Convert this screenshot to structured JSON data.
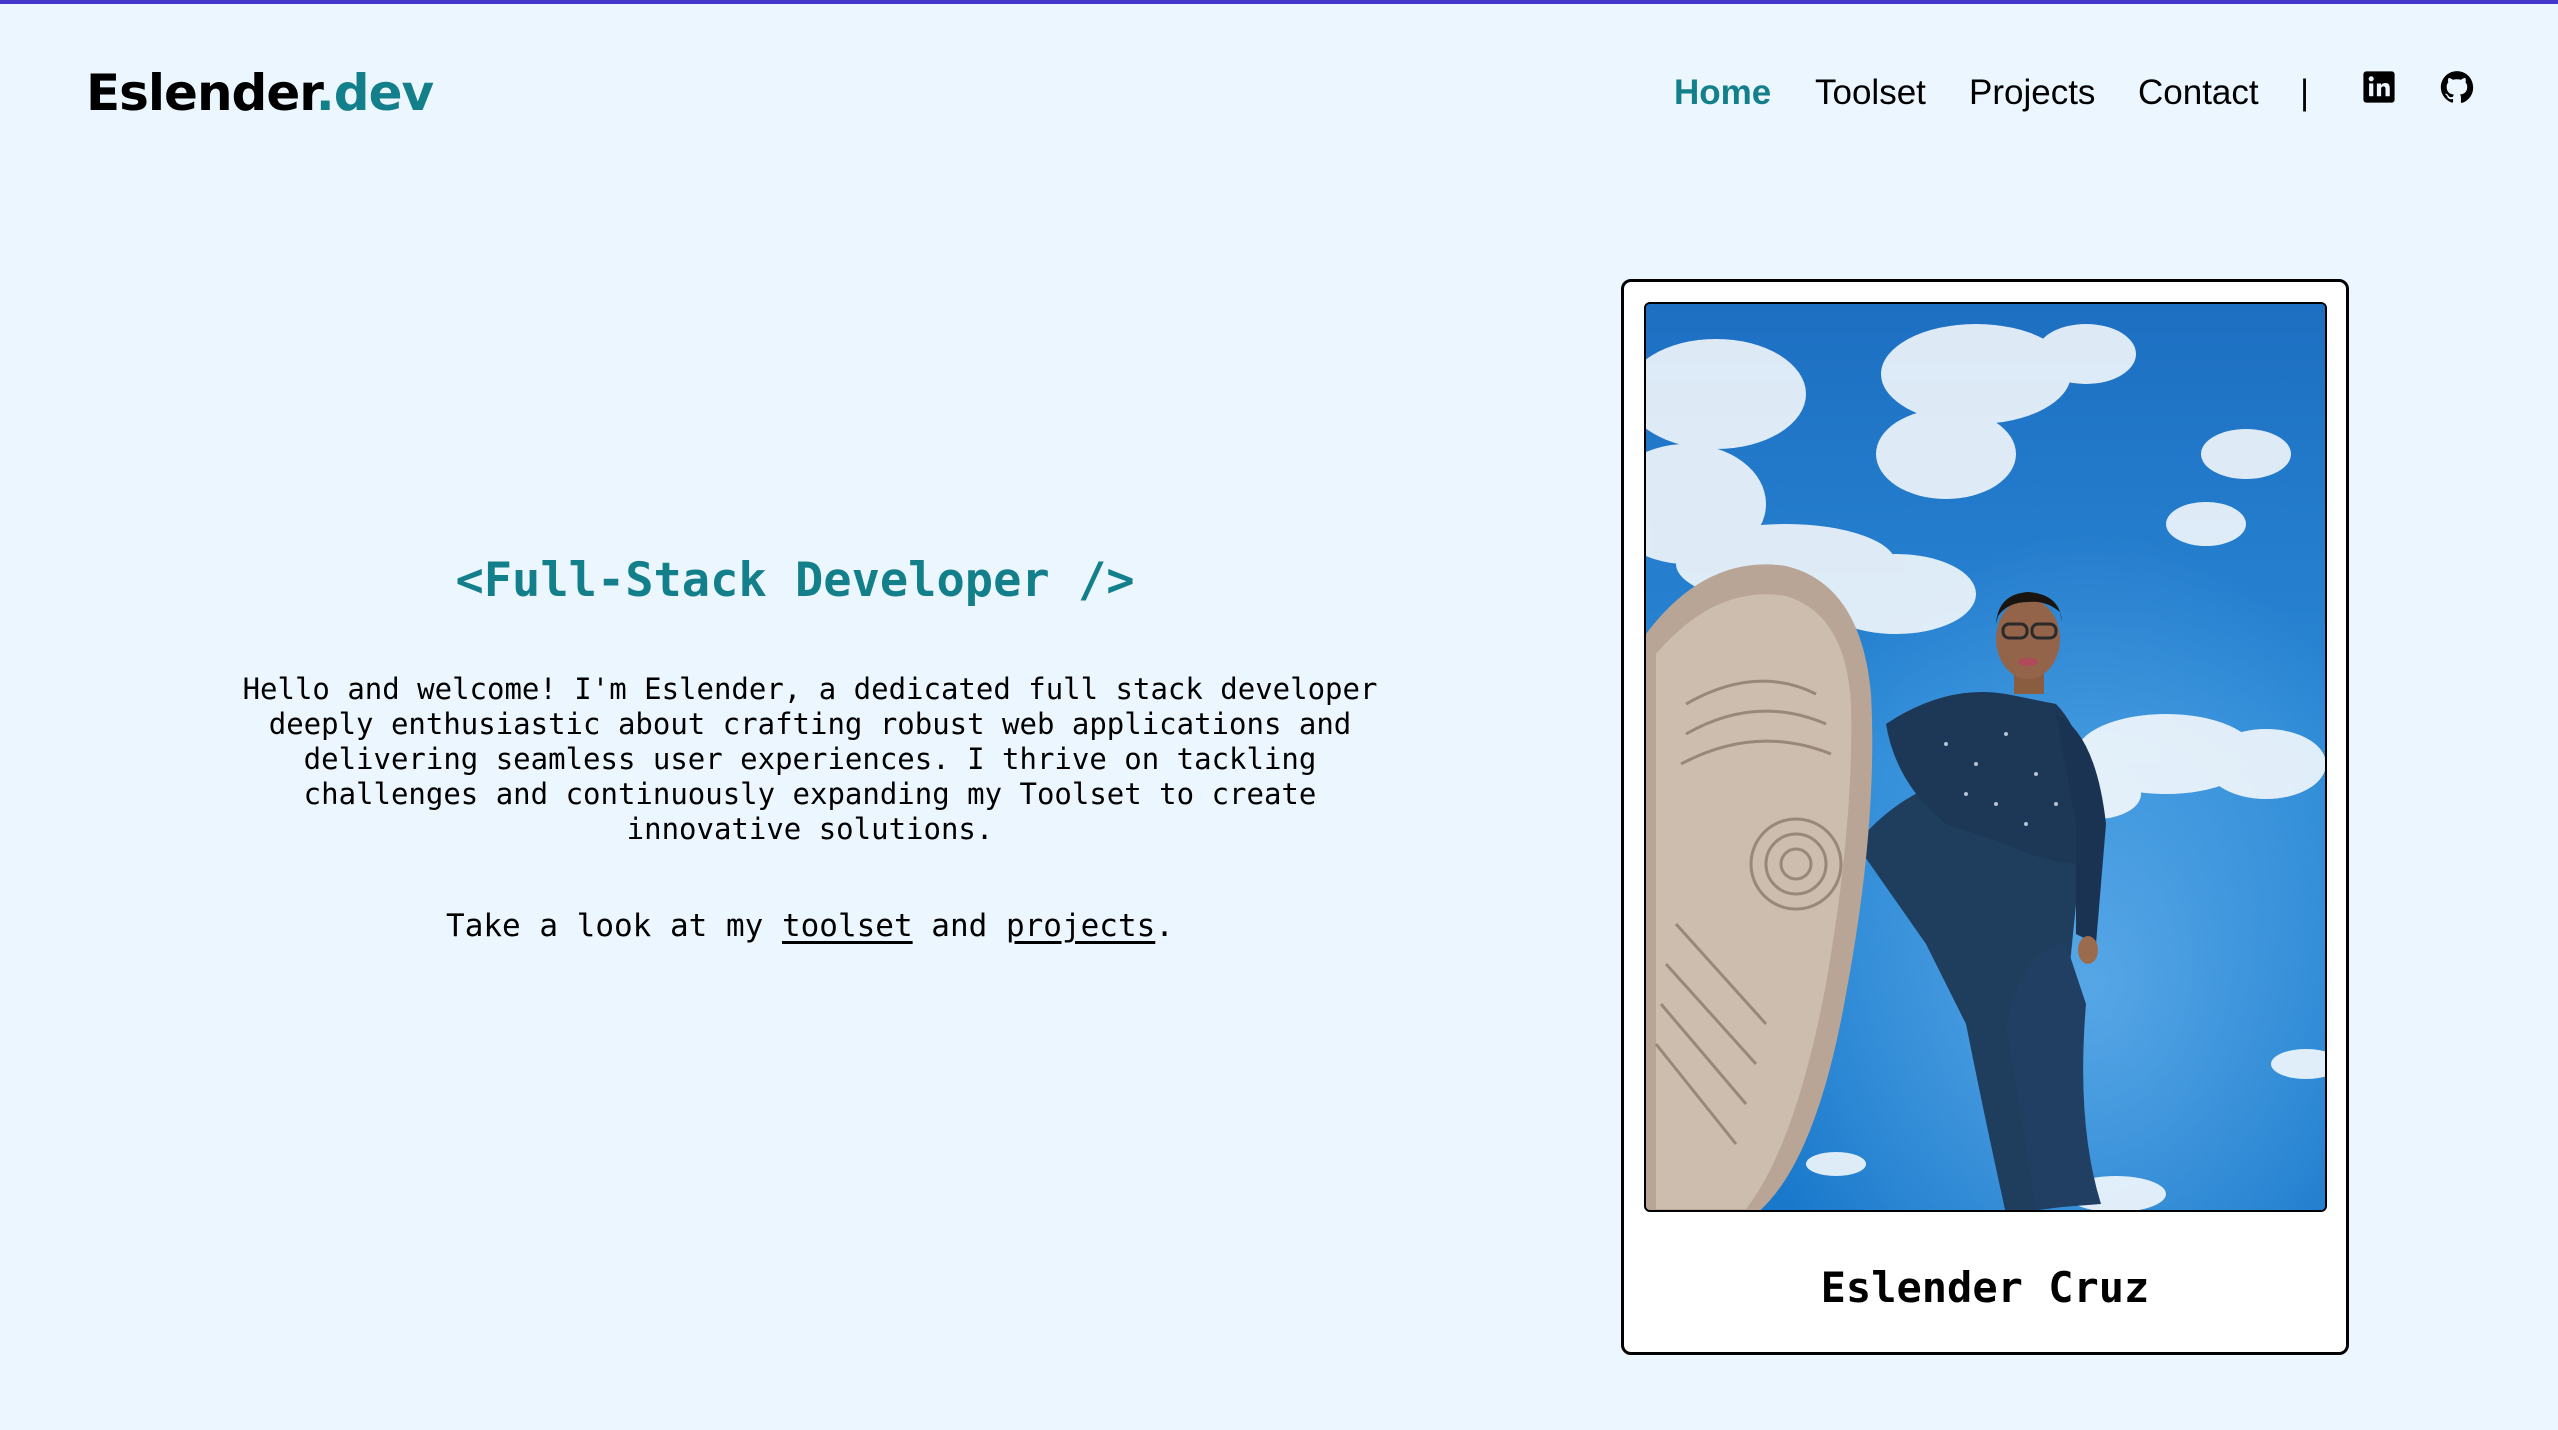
{
  "brand": {
    "name_main": "Eslender",
    "name_suffix": ".dev",
    "accent_color": "#137f8a"
  },
  "nav": {
    "items": [
      {
        "label": "Home",
        "active": true
      },
      {
        "label": "Toolset",
        "active": false
      },
      {
        "label": "Projects",
        "active": false
      },
      {
        "label": "Contact",
        "active": false
      }
    ],
    "separator": "|",
    "social": [
      {
        "icon": "linkedin-icon"
      },
      {
        "icon": "github-icon"
      }
    ]
  },
  "hero": {
    "title": "<Full-Stack Developer />",
    "intro_lines": [
      "Hello and welcome! I'm Eslender, a dedicated full stack developer",
      "deeply enthusiastic about crafting robust web applications and",
      "delivering seamless user experiences. I thrive on tackling",
      "challenges and continuously expanding my Toolset to create",
      "innovative solutions."
    ],
    "cta_prefix": "Take a look at my ",
    "cta_link1": "toolset",
    "cta_middle": " and ",
    "cta_link2": "projects",
    "cta_suffix": "."
  },
  "profile": {
    "name": "Eslender Cruz",
    "photo_icon": "profile-photo"
  },
  "colors": {
    "background": "#ecf6fe",
    "top_accent": "#4338ca"
  }
}
